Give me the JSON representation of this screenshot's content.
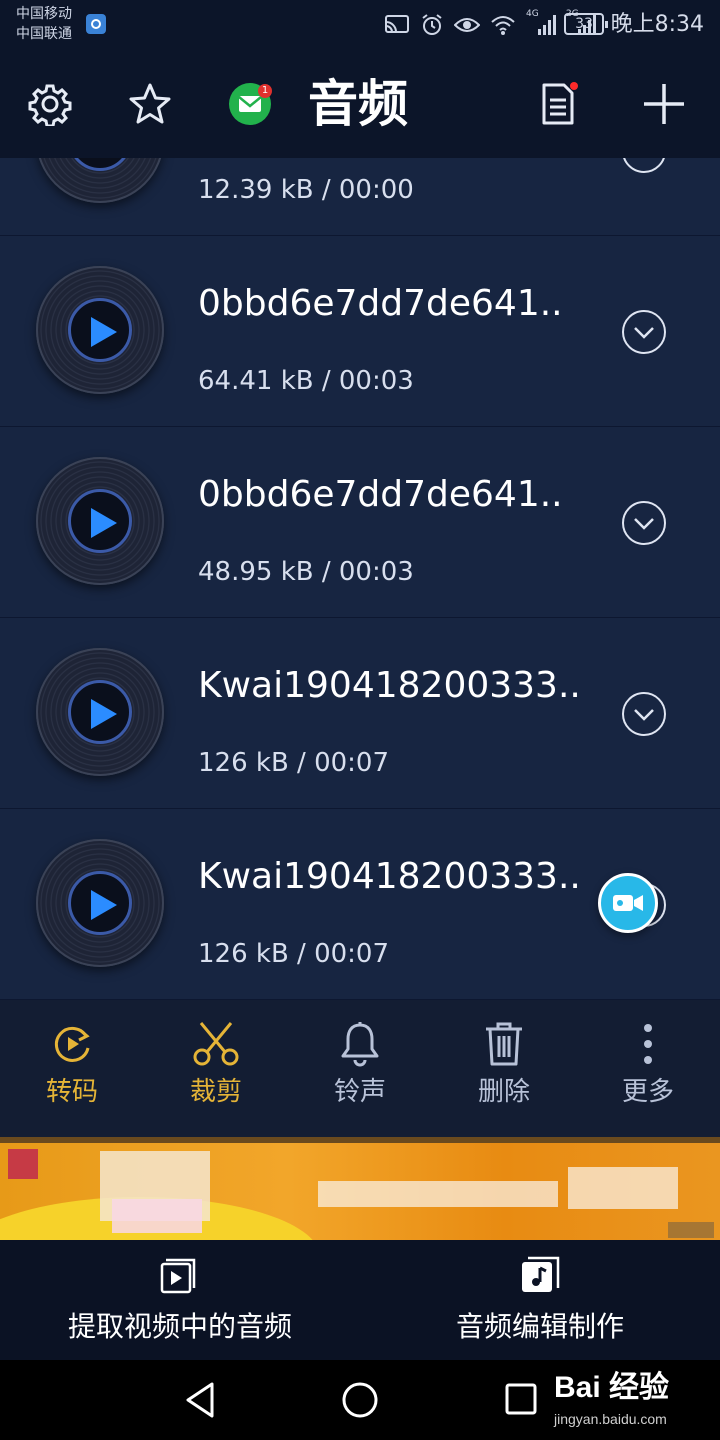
{
  "status_bar": {
    "carrier_1": "中国移动",
    "carrier_2": "中国联通",
    "network_1": "4G",
    "network_2": "2G",
    "battery": "33",
    "time": "晚上8:34"
  },
  "toolbar": {
    "title": "音频",
    "mail_badge": "1",
    "icons": [
      "gear-icon",
      "star-icon",
      "mail-icon",
      "document-icon",
      "plus-icon"
    ]
  },
  "files": [
    {
      "title": "",
      "meta": "12.39 kB / 00:00"
    },
    {
      "title": "0bbd6e7dd7de641..",
      "meta": "64.41 kB / 00:03"
    },
    {
      "title": "0bbd6e7dd7de641..",
      "meta": "48.95 kB / 00:03"
    },
    {
      "title": "Kwai190418200333..",
      "meta": "126 kB / 00:07"
    },
    {
      "title": "Kwai190418200333..",
      "meta": "126 kB / 00:07"
    }
  ],
  "actions": [
    {
      "label": "转码",
      "icon": "convert-icon",
      "color": "#e5b437"
    },
    {
      "label": "裁剪",
      "icon": "scissors-icon",
      "color": "#e5b437"
    },
    {
      "label": "铃声",
      "icon": "bell-icon",
      "color": "#b8c2d8"
    },
    {
      "label": "删除",
      "icon": "trash-icon",
      "color": "#b8c2d8"
    },
    {
      "label": "更多",
      "icon": "more-icon",
      "color": "#b8c2d8"
    }
  ],
  "bottom_nav": [
    {
      "label": "提取视频中的音频",
      "icon": "video-play-icon"
    },
    {
      "label": "音频编辑制作",
      "icon": "music-note-icon"
    }
  ],
  "watermark": {
    "main": "Bai 经验",
    "sub": "jingyan.baidu.com"
  },
  "colors": {
    "background": "#0c1529",
    "row_background": "#172541",
    "accent_gold": "#e5b437",
    "play_blue": "#2b8cff",
    "fab": "#28b8e8"
  }
}
